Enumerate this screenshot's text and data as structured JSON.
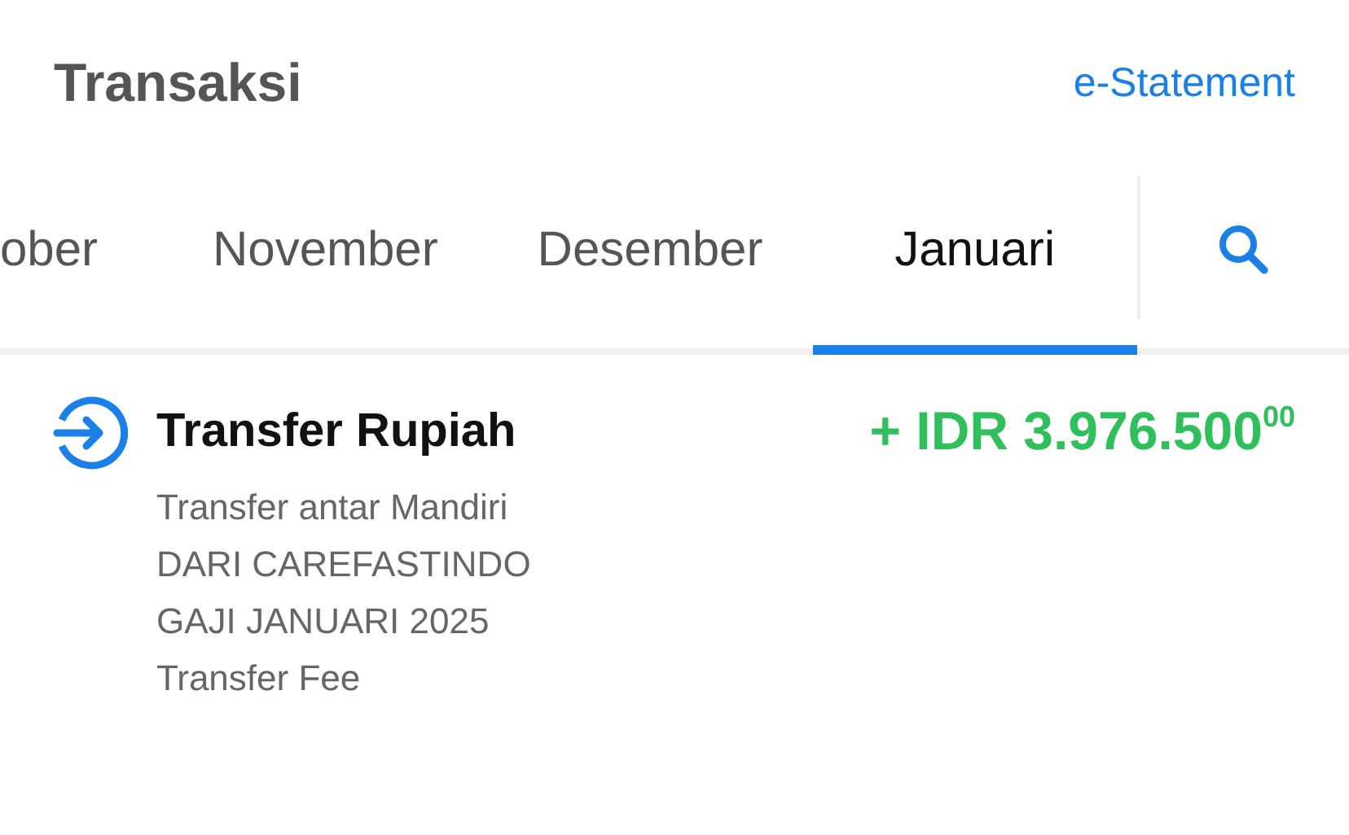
{
  "header": {
    "title": "Transaksi",
    "link": "e-Statement"
  },
  "tabs": [
    {
      "label": "ober",
      "kind": "partial",
      "selected": false
    },
    {
      "label": "November",
      "kind": "full",
      "selected": false
    },
    {
      "label": "Desember",
      "kind": "full",
      "selected": false
    },
    {
      "label": "Januari",
      "kind": "full",
      "selected": true
    }
  ],
  "transactions": [
    {
      "title": "Transfer Rupiah",
      "amount": "+ IDR 3.976.500",
      "cents": "00",
      "details": [
        "Transfer antar Mandiri",
        "DARI CAREFASTINDO",
        "GAJI JANUARI 2025",
        "Transfer Fee"
      ]
    }
  ]
}
